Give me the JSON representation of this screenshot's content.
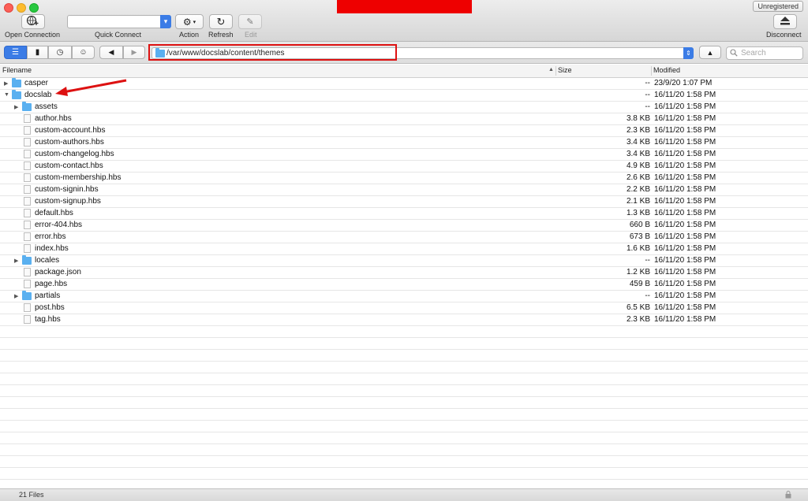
{
  "toolbar": {
    "unregistered": "Unregistered",
    "open_connection": "Open Connection",
    "quick_connect": "Quick Connect",
    "action": "Action",
    "refresh": "Refresh",
    "edit": "Edit",
    "disconnect": "Disconnect"
  },
  "nav": {
    "path": "/var/www/docslab/content/themes",
    "search_placeholder": "Search"
  },
  "columns": {
    "filename": "Filename",
    "size": "Size",
    "modified": "Modified"
  },
  "files": [
    {
      "name": "casper",
      "type": "folder",
      "expanded": false,
      "depth": 0,
      "size": "--",
      "modified": "23/9/20 1:07 PM"
    },
    {
      "name": "docslab",
      "type": "folder",
      "expanded": true,
      "depth": 0,
      "size": "--",
      "modified": "16/11/20 1:58 PM"
    },
    {
      "name": "assets",
      "type": "folder",
      "expanded": false,
      "depth": 1,
      "size": "--",
      "modified": "16/11/20 1:58 PM"
    },
    {
      "name": "author.hbs",
      "type": "file",
      "depth": 1,
      "size": "3.8 KB",
      "modified": "16/11/20 1:58 PM"
    },
    {
      "name": "custom-account.hbs",
      "type": "file",
      "depth": 1,
      "size": "2.3 KB",
      "modified": "16/11/20 1:58 PM"
    },
    {
      "name": "custom-authors.hbs",
      "type": "file",
      "depth": 1,
      "size": "3.4 KB",
      "modified": "16/11/20 1:58 PM"
    },
    {
      "name": "custom-changelog.hbs",
      "type": "file",
      "depth": 1,
      "size": "3.4 KB",
      "modified": "16/11/20 1:58 PM"
    },
    {
      "name": "custom-contact.hbs",
      "type": "file",
      "depth": 1,
      "size": "4.9 KB",
      "modified": "16/11/20 1:58 PM"
    },
    {
      "name": "custom-membership.hbs",
      "type": "file",
      "depth": 1,
      "size": "2.6 KB",
      "modified": "16/11/20 1:58 PM"
    },
    {
      "name": "custom-signin.hbs",
      "type": "file",
      "depth": 1,
      "size": "2.2 KB",
      "modified": "16/11/20 1:58 PM"
    },
    {
      "name": "custom-signup.hbs",
      "type": "file",
      "depth": 1,
      "size": "2.1 KB",
      "modified": "16/11/20 1:58 PM"
    },
    {
      "name": "default.hbs",
      "type": "file",
      "depth": 1,
      "size": "1.3 KB",
      "modified": "16/11/20 1:58 PM"
    },
    {
      "name": "error-404.hbs",
      "type": "file",
      "depth": 1,
      "size": "660 B",
      "modified": "16/11/20 1:58 PM"
    },
    {
      "name": "error.hbs",
      "type": "file",
      "depth": 1,
      "size": "673 B",
      "modified": "16/11/20 1:58 PM"
    },
    {
      "name": "index.hbs",
      "type": "file",
      "depth": 1,
      "size": "1.6 KB",
      "modified": "16/11/20 1:58 PM"
    },
    {
      "name": "locales",
      "type": "folder",
      "expanded": false,
      "depth": 1,
      "size": "--",
      "modified": "16/11/20 1:58 PM"
    },
    {
      "name": "package.json",
      "type": "file",
      "depth": 1,
      "size": "1.2 KB",
      "modified": "16/11/20 1:58 PM"
    },
    {
      "name": "page.hbs",
      "type": "file",
      "depth": 1,
      "size": "459 B",
      "modified": "16/11/20 1:58 PM"
    },
    {
      "name": "partials",
      "type": "folder",
      "expanded": false,
      "depth": 1,
      "size": "--",
      "modified": "16/11/20 1:58 PM"
    },
    {
      "name": "post.hbs",
      "type": "file",
      "depth": 1,
      "size": "6.5 KB",
      "modified": "16/11/20 1:58 PM"
    },
    {
      "name": "tag.hbs",
      "type": "file",
      "depth": 1,
      "size": "2.3 KB",
      "modified": "16/11/20 1:58 PM"
    }
  ],
  "status": {
    "text": "21 Files"
  },
  "colors": {
    "accent": "#3b7ce6",
    "folder": "#5ab0f0",
    "annotation": "#dd1111"
  }
}
